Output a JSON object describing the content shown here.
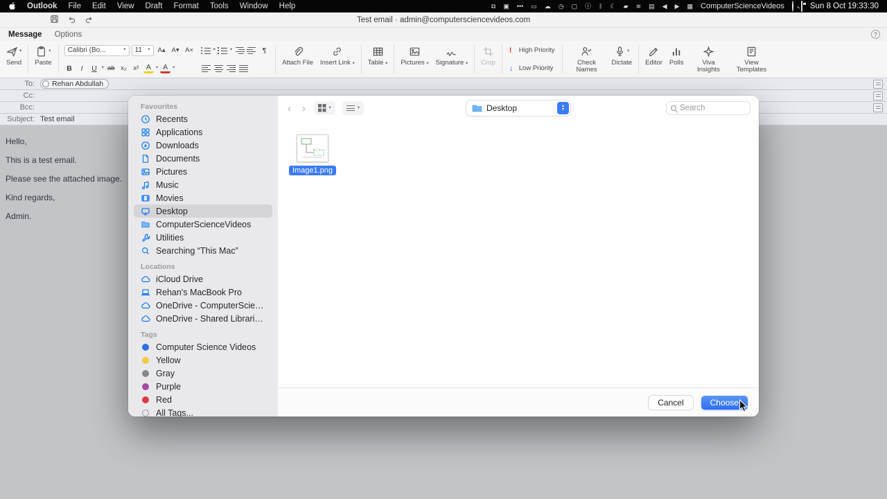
{
  "menubar": {
    "items": [
      "Outlook",
      "File",
      "Edit",
      "View",
      "Draft",
      "Format",
      "Tools",
      "Window",
      "Help"
    ],
    "icons": [
      {
        "name": "screen-mirroring-icon",
        "glyph": "⧉"
      },
      {
        "name": "camera-icon",
        "glyph": "▣"
      },
      {
        "name": "hotspot-icon",
        "glyph": "•••"
      },
      {
        "name": "stage-manager-icon",
        "glyph": "▭"
      },
      {
        "name": "cloud-icon",
        "glyph": "☁"
      },
      {
        "name": "time-machine-icon",
        "glyph": "◷"
      },
      {
        "name": "window-icon",
        "glyph": "▢"
      },
      {
        "name": "info-icon",
        "glyph": "ⓘ"
      },
      {
        "name": "bluetooth-icon",
        "glyph": "ᛒ"
      },
      {
        "name": "focus-icon",
        "glyph": "☾"
      },
      {
        "name": "battery-icon",
        "glyph": "▰"
      },
      {
        "name": "wifi-icon",
        "glyph": "≋"
      },
      {
        "name": "display-icon",
        "glyph": "▤"
      },
      {
        "name": "volume-icon",
        "glyph": "◀"
      },
      {
        "name": "play-icon",
        "glyph": "▶"
      },
      {
        "name": "keyboard-icon",
        "glyph": "▦"
      }
    ],
    "status_text": "ComputerScienceVideos",
    "clock": "Sun 8 Oct 19:33:30"
  },
  "titlebar": {
    "title": "Test email · admin@computersciencevideos.com"
  },
  "tabs": {
    "message": "Message",
    "options": "Options"
  },
  "ui": {
    "chevron": "▾",
    "up": "▴",
    "down": "▾",
    "back": "‹",
    "forward": "›",
    "help": "?"
  },
  "ribbon": {
    "send_label": "Send",
    "paste_label": "Paste",
    "font_name": "Calibri (Bo...",
    "font_size": "11",
    "grow_font": "A▴",
    "shrink_font": "A▾",
    "clear_format": "A×",
    "bold": "B",
    "italic": "I",
    "underline": "U",
    "strike": "ab",
    "subscript": "x₂",
    "superscript": "x²",
    "highlight": "A",
    "font_color": "A",
    "paragraph": "¶",
    "attach_file": "Attach File",
    "insert_link": "Insert Link",
    "table": "Table",
    "pictures": "Pictures",
    "signature": "Signature",
    "crop": "Crop",
    "high_glyph": "!",
    "high_priority": "High Priority",
    "low_glyph": "↓",
    "low_priority": "Low Priority",
    "check_names": "Check Names",
    "dictate": "Dictate",
    "editor": "Editor",
    "polls": "Polls",
    "viva_insights": "Viva Insights",
    "view_templates": "View Templates"
  },
  "fields": {
    "to_label": "To:",
    "to_chip": "Rehan Abdullah",
    "cc_label": "Cc:",
    "bcc_label": "Bcc:",
    "subject_label": "Subject:",
    "subject_value": "Test email"
  },
  "body": {
    "lines": [
      "Hello,",
      "This is a test email.",
      "Please see the attached image.",
      "Kind regards,",
      "Admin."
    ]
  },
  "dialog": {
    "toolbar": {
      "location": "Desktop",
      "search_placeholder": "Search"
    },
    "sidebar": {
      "headings": {
        "favourites": "Favourites",
        "locations": "Locations",
        "tags": "Tags"
      },
      "favourites": [
        {
          "label": "Recents",
          "icon": "clock"
        },
        {
          "label": "Applications",
          "icon": "apps-grid"
        },
        {
          "label": "Downloads",
          "icon": "download-circle"
        },
        {
          "label": "Documents",
          "icon": "document"
        },
        {
          "label": "Pictures",
          "icon": "photo"
        },
        {
          "label": "Music",
          "icon": "music-note"
        },
        {
          "label": "Movies",
          "icon": "film"
        },
        {
          "label": "Desktop",
          "icon": "desktop-monitor",
          "selected": true
        },
        {
          "label": "ComputerScienceVideos",
          "icon": "folder"
        },
        {
          "label": "Utilities",
          "icon": "wrench"
        },
        {
          "label": "Searching “This Mac”",
          "icon": "magnifier"
        }
      ],
      "locations": [
        {
          "label": "iCloud Drive",
          "icon": "cloud"
        },
        {
          "label": "Rehan's MacBook Pro",
          "icon": "laptop"
        },
        {
          "label": "OneDrive - ComputerScienceVideos",
          "icon": "cloud"
        },
        {
          "label": "OneDrive - Shared Libraries - Com...",
          "icon": "cloud"
        }
      ],
      "tags": [
        {
          "label": "Computer Science Videos",
          "color": "#2f6fe4"
        },
        {
          "label": "Yellow",
          "color": "#f6c944"
        },
        {
          "label": "Gray",
          "color": "#86868b"
        },
        {
          "label": "Purple",
          "color": "#a24ca6"
        },
        {
          "label": "Red",
          "color": "#dd3b41"
        },
        {
          "label": "All Tags...",
          "color": "none"
        }
      ]
    },
    "file": {
      "name": "Image1.png"
    },
    "footer": {
      "cancel": "Cancel",
      "choose": "Choose"
    }
  },
  "colors": {
    "accent_blue": "#3a7af7",
    "selected_row": "#d4d4d9",
    "menubar_bg": "#060606"
  }
}
